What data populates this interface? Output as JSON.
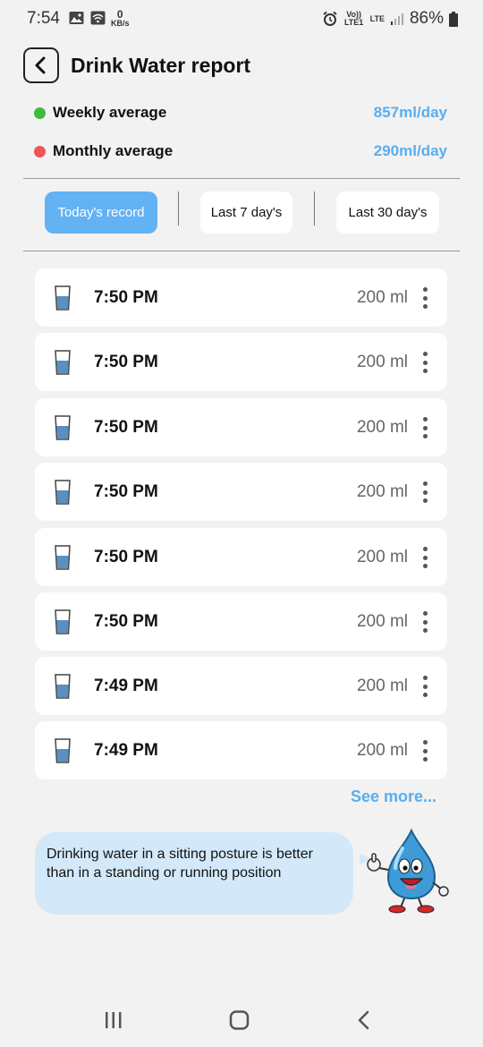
{
  "status_bar": {
    "time": "7:54",
    "net_speed_value": "0",
    "net_speed_unit": "KB/s",
    "volte_label": "Vo)) LTE1",
    "lte_label": "LTE",
    "battery": "86%"
  },
  "header": {
    "title": "Drink Water report"
  },
  "averages": {
    "weekly_label": "Weekly average",
    "weekly_value": "857ml/day",
    "monthly_label": "Monthly average",
    "monthly_value": "290ml/day"
  },
  "colors": {
    "accent": "#62b2f4",
    "value_text": "#58aef0",
    "weekly_dot": "#3dbb3d",
    "monthly_dot": "#ee5555",
    "tip_bg": "#d3e9fa"
  },
  "tabs": [
    {
      "label": "Today's record",
      "active": true
    },
    {
      "label": "Last 7 day's",
      "active": false
    },
    {
      "label": "Last 30 day's",
      "active": false
    }
  ],
  "records": [
    {
      "time": "7:50 PM",
      "amount": "200 ml",
      "icon": "water-glass-icon"
    },
    {
      "time": "7:50 PM",
      "amount": "200 ml",
      "icon": "water-glass-icon"
    },
    {
      "time": "7:50 PM",
      "amount": "200 ml",
      "icon": "water-glass-icon"
    },
    {
      "time": "7:50 PM",
      "amount": "200 ml",
      "icon": "water-glass-icon"
    },
    {
      "time": "7:50 PM",
      "amount": "200 ml",
      "icon": "water-glass-icon"
    },
    {
      "time": "7:50 PM",
      "amount": "200 ml",
      "icon": "water-glass-icon"
    },
    {
      "time": "7:49 PM",
      "amount": "200 ml",
      "icon": "water-glass-icon"
    },
    {
      "time": "7:49 PM",
      "amount": "200 ml",
      "icon": "water-glass-icon"
    }
  ],
  "see_more_label": "See more...",
  "tip": {
    "text": "Drinking water in a sitting posture is better than in a standing or running position",
    "mascot_icon": "water-drop-mascot-icon"
  },
  "nav": {
    "recents_icon": "recents-icon",
    "home_icon": "home-icon",
    "back_icon": "back-icon"
  }
}
